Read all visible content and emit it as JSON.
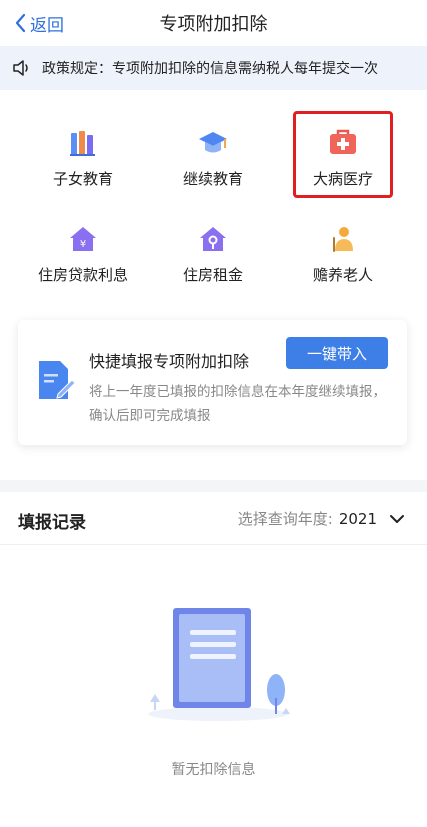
{
  "header": {
    "back_label": "返回",
    "title": "专项附加扣除"
  },
  "notice": {
    "text": "政策规定：专项附加扣除的信息需纳税人每年提交一次"
  },
  "grid": {
    "items": [
      {
        "label": "子女教育",
        "icon": "books-icon"
      },
      {
        "label": "继续教育",
        "icon": "graduation-cap-icon"
      },
      {
        "label": "大病医疗",
        "icon": "medical-kit-icon"
      },
      {
        "label": "住房贷款利息",
        "icon": "house-yuan-icon"
      },
      {
        "label": "住房租金",
        "icon": "house-key-icon"
      },
      {
        "label": "赡养老人",
        "icon": "elderly-person-icon"
      }
    ],
    "highlighted": "大病医疗"
  },
  "quick": {
    "title": "快捷填报专项附加扣除",
    "description": "将上一年度已填报的扣除信息在本年度继续填报，确认后即可完成填报",
    "button_label": "一键带入"
  },
  "records": {
    "title": "填报记录",
    "year_label": "选择查询年度:",
    "year_value": "2021",
    "empty_text": "暂无扣除信息"
  },
  "colors": {
    "accent": "#3d7fe6",
    "highlight_border": "#e02020",
    "notice_bg": "#eef3fb"
  }
}
